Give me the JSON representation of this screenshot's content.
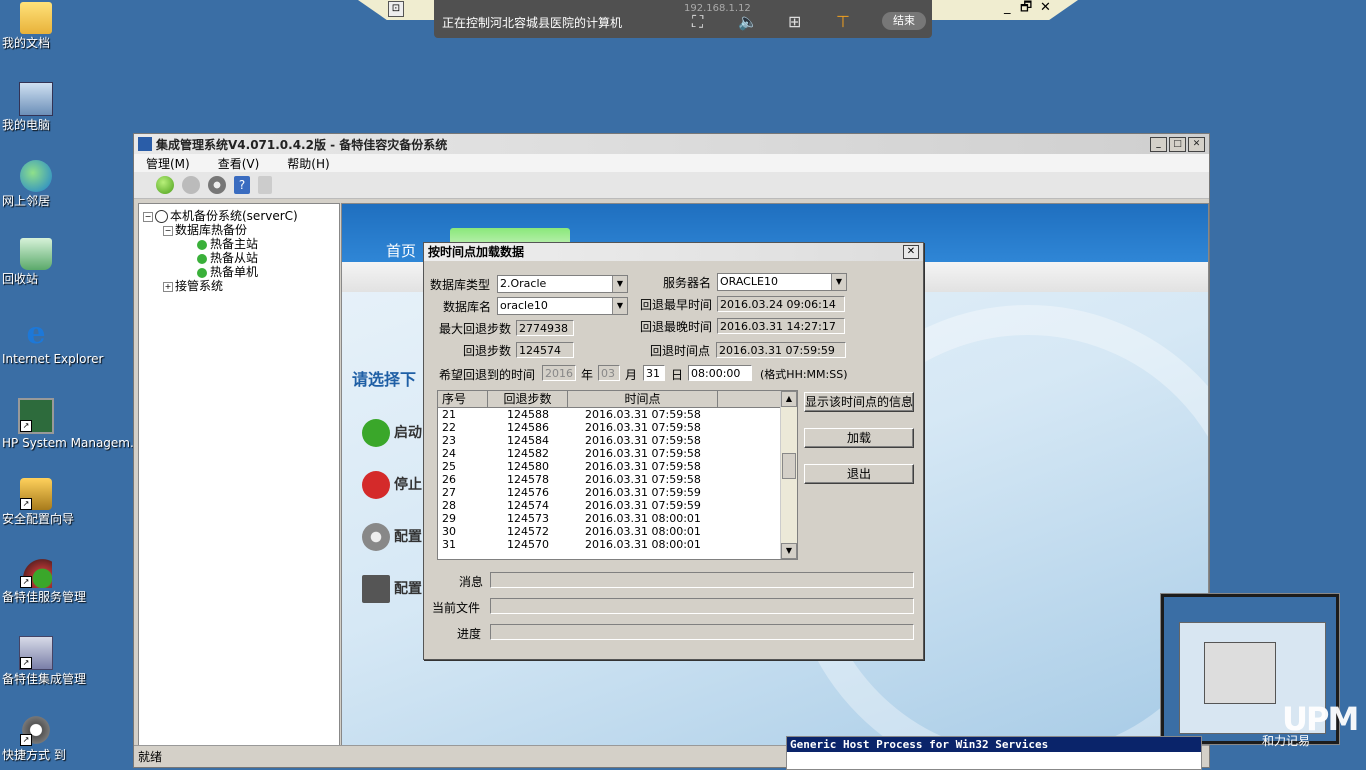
{
  "desktop": {
    "icons": [
      {
        "label": "我的文档",
        "icon": "folder-icon"
      },
      {
        "label": "我的电脑",
        "icon": "computer-icon"
      },
      {
        "label": "网上邻居",
        "icon": "network-icon"
      },
      {
        "label": "回收站",
        "icon": "recycle-bin-icon"
      },
      {
        "label": "Internet Explorer",
        "icon": "internet-explorer-icon"
      },
      {
        "label": "HP System Managem...",
        "icon": "hp-system-management-icon"
      },
      {
        "label": "安全配置向导",
        "icon": "security-wizard-icon"
      },
      {
        "label": "备特佳服务管理",
        "icon": "service-management-icon"
      },
      {
        "label": "备特佳集成管理",
        "icon": "integration-management-icon"
      },
      {
        "label": "快捷方式 到",
        "icon": "shortcut-icon"
      }
    ]
  },
  "remote_control": {
    "title": "正在控制河北容城县医院的计算机",
    "ip": "192.168.1.12",
    "end_label": "结束",
    "window_controls": [
      "_",
      "🗗",
      "✕"
    ]
  },
  "main_window": {
    "title": "集成管理系统V4.071.0.4.2版  - 备特佳容灾备份系统",
    "menus": [
      "管理(M)",
      "查看(V)",
      "帮助(H)"
    ],
    "status": "就绪",
    "tree": {
      "root": "本机备份系统(serverC)",
      "group1": "数据库热备份",
      "children": [
        "热备主站",
        "热备从站",
        "热备单机"
      ],
      "group2": "接管系统"
    },
    "content": {
      "home_link": "首页",
      "select_prompt": "请选择下",
      "actions": [
        {
          "label": "启动",
          "icon": "start-icon",
          "color": "#3aa72a"
        },
        {
          "label": "停止",
          "icon": "stop-icon",
          "color": "#d42a2a"
        },
        {
          "label": "配置",
          "icon": "settings-icon",
          "color": "#888888"
        },
        {
          "label": "配置",
          "icon": "monitor-icon",
          "color": "#555555"
        }
      ]
    }
  },
  "dialog": {
    "title": "按时间点加载数据",
    "db_type_label": "数据库类型",
    "db_type_value": "2.Oracle",
    "server_name_label": "服务器名",
    "server_name_value": "ORACLE10",
    "db_name_label": "数据库名",
    "db_name_value": "oracle10",
    "earliest_label": "回退最早时间",
    "earliest_value": "2016.03.24 09:06:14",
    "max_steps_label": "最大回退步数",
    "max_steps_value": "2774938",
    "latest_label": "回退最晚时间",
    "latest_value": "2016.03.31 14:27:17",
    "steps_label": "回退步数",
    "steps_value": "124574",
    "point_label": "回退时间点",
    "point_value": "2016.03.31 07:59:59",
    "target_label": "希望回退到的时间",
    "year_value": "2016",
    "year_unit": "年",
    "month_value": "03",
    "month_unit": "月",
    "day_value": "31",
    "day_unit": "日",
    "time_value": "08:00:00",
    "format_hint": "(格式HH:MM:SS)",
    "columns": [
      "序号",
      "回退步数",
      "时间点"
    ],
    "rows": [
      [
        "21",
        "124588",
        "2016.03.31 07:59:58"
      ],
      [
        "22",
        "124586",
        "2016.03.31 07:59:58"
      ],
      [
        "23",
        "124584",
        "2016.03.31 07:59:58"
      ],
      [
        "24",
        "124582",
        "2016.03.31 07:59:58"
      ],
      [
        "25",
        "124580",
        "2016.03.31 07:59:58"
      ],
      [
        "26",
        "124578",
        "2016.03.31 07:59:58"
      ],
      [
        "27",
        "124576",
        "2016.03.31 07:59:59"
      ],
      [
        "28",
        "124574",
        "2016.03.31 07:59:59"
      ],
      [
        "29",
        "124573",
        "2016.03.31 08:00:01"
      ],
      [
        "30",
        "124572",
        "2016.03.31 08:00:01"
      ],
      [
        "31",
        "124570",
        "2016.03.31 08:00:01"
      ]
    ],
    "btn_show_info": "显示该时间点的信息",
    "btn_load": "加载",
    "btn_exit": "退出",
    "msg_label": "消息",
    "file_label": "当前文件",
    "progress_label": "进度"
  },
  "overlay": {
    "watermark": "UPM",
    "watermark_sub": "和力记易",
    "task_popup": "Generic Host Process for Win32 Services"
  }
}
